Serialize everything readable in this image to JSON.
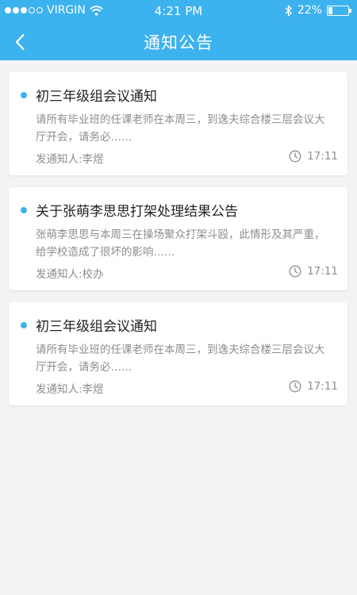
{
  "status_bar": {
    "carrier": "VIRGIN",
    "time": "4:21 PM",
    "battery": "22%",
    "battery_level": 0.22
  },
  "nav": {
    "title": "通知公告",
    "back_icon": "chevron-left-icon"
  },
  "colors": {
    "header": "#3cb2ef",
    "accent_dot": "#3cb2ef",
    "text_main": "#222222",
    "text_muted": "#8d8d8d"
  },
  "notices": [
    {
      "title": "初三年级组会议通知",
      "body": "请所有毕业班的任课老师在本周三，到逸夫综合楼三层会议大厅开会，请务必……",
      "sender": "发通知人:李煜",
      "time": "17:11"
    },
    {
      "title": "关于张萌李思思打架处理结果公告",
      "body": "张萌李思思与本周三在操场聚众打架斗殴，此情形及其严重，给学校造成了很坏的影响……",
      "sender": "发通知人:校办",
      "time": "17:11"
    },
    {
      "title": "初三年级组会议通知",
      "body": "请所有毕业班的任课老师在本周三，到逸夫综合楼三层会议大厅开会，请务必……",
      "sender": "发通知人:李煜",
      "time": "17:11"
    }
  ]
}
